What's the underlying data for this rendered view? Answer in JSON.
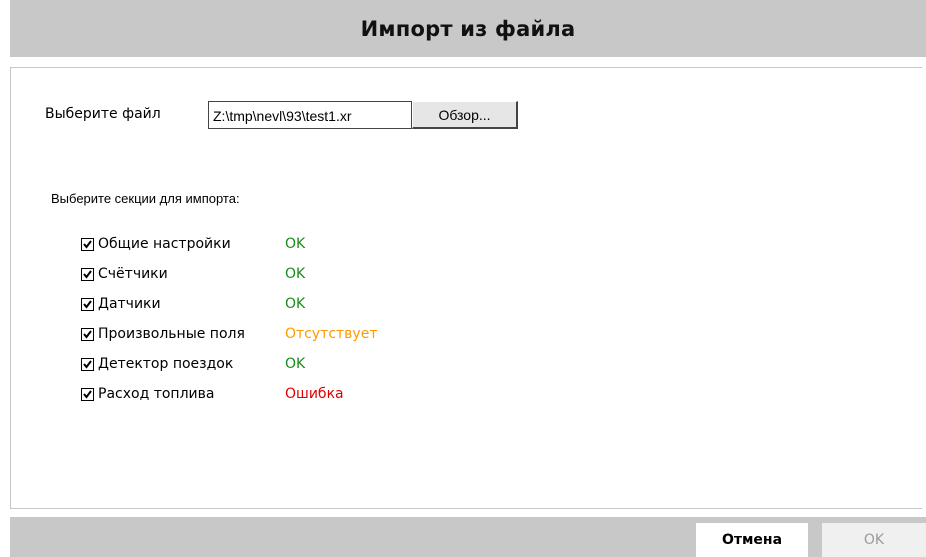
{
  "dialog": {
    "title": "Импорт из файла"
  },
  "file": {
    "label": "Выберите файл",
    "value": "Z:\\tmp\\nevl\\93\\test1.xr",
    "browse_label": "Обзор..."
  },
  "sections": {
    "label": "Выберите секции для импорта:",
    "items": [
      {
        "label": "Общие настройки",
        "checked": true,
        "status": "OK",
        "status_color": "#1a8a1a"
      },
      {
        "label": "Счётчики",
        "checked": true,
        "status": "OK",
        "status_color": "#1a8a1a"
      },
      {
        "label": "Датчики",
        "checked": true,
        "status": "OK",
        "status_color": "#1a8a1a"
      },
      {
        "label": "Произвольные поля",
        "checked": true,
        "status": "Отсутствует",
        "status_color": "#ff9900"
      },
      {
        "label": "Детектор поездок",
        "checked": true,
        "status": "OK",
        "status_color": "#1a8a1a"
      },
      {
        "label": "Расход топлива",
        "checked": true,
        "status": "Ошибка",
        "status_color": "#e00000"
      }
    ]
  },
  "footer": {
    "cancel_label": "Отмена",
    "ok_label": "OK"
  },
  "colors": {
    "bar_gray": "#c8c8c8",
    "ok_green": "#1a8a1a",
    "missing_orange": "#ff9900",
    "error_red": "#e00000"
  }
}
